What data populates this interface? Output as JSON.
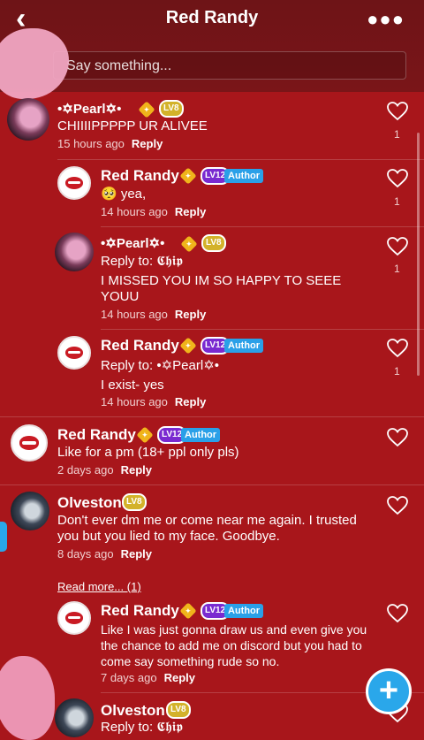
{
  "header": {
    "title": "Red Randy",
    "back_icon": "back-chevron-icon",
    "more_icon": "more-dots-icon"
  },
  "compose": {
    "placeholder": "Say something..."
  },
  "comments": [
    {
      "name": "•✡Pearl✡•",
      "lv": "LV8",
      "text": "CHIIIIPPPPP UR ALIVEE",
      "time": "15 hours ago",
      "reply": "Reply",
      "likes": "1"
    },
    {
      "name": "Red Randy",
      "lv": "LV12",
      "author": "Author",
      "text": "🥺 yea,",
      "time": "14 hours ago",
      "reply": "Reply",
      "likes": "1"
    },
    {
      "name": "•✡Pearl✡•",
      "lv": "LV8",
      "reply_to": "Reply to: 𝕮𝖍𝖎𝖕",
      "text": "I MISSED YOU IM SO HAPPY TO SEEE YOUU",
      "time": "14 hours ago",
      "reply": "Reply",
      "likes": "1"
    },
    {
      "name": "Red Randy",
      "lv": "LV12",
      "author": "Author",
      "reply_to": "Reply to: •✡Pearl✡•",
      "text": "I exist- yes",
      "time": "14 hours ago",
      "reply": "Reply",
      "likes": "1"
    },
    {
      "name": "Red Randy",
      "lv": "LV12",
      "author": "Author",
      "text": "Like for a pm (18+ ppl only pls)",
      "time": "2 days ago",
      "reply": "Reply"
    },
    {
      "name": "Olveston",
      "lv": "LV8",
      "text": "Don't ever dm me or come near me again. I trusted you but you lied to my face. Goodbye.",
      "time": "8 days ago",
      "reply": "Reply"
    },
    {
      "name": "Red Randy",
      "lv": "LV12",
      "author": "Author",
      "text": "Like I was just gonna draw us and even give you the chance to add me on discord but you had to come say something rude so no.",
      "time": "7 days ago",
      "reply": "Reply"
    },
    {
      "name": "Olveston",
      "lv": "LV8",
      "reply_to": "Reply to: 𝕮𝖍𝖎𝖕"
    }
  ],
  "read_more": "Read more... (1)",
  "fab": {
    "icon": "plus-icon"
  }
}
